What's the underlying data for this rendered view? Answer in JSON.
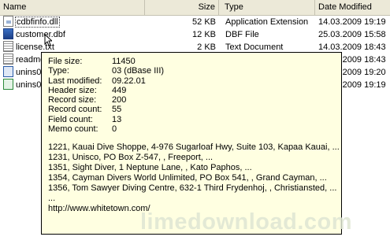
{
  "columns": {
    "name": "Name",
    "size": "Size",
    "type": "Type",
    "date": "Date Modified"
  },
  "files": [
    {
      "name": "cdbfinfo.dll",
      "size": "52 KB",
      "type": "Application Extension",
      "date": "14.03.2009 19:19",
      "icon": "dll-file-icon"
    },
    {
      "name": "customer.dbf",
      "size": "12 KB",
      "type": "DBF File",
      "date": "25.03.2009 15:58",
      "icon": "dbf-file-icon"
    },
    {
      "name": "license.txt",
      "size": "2 KB",
      "type": "Text Document",
      "date": "14.03.2009 18:43",
      "icon": "text-file-icon"
    },
    {
      "name": "readme.txt",
      "size": "",
      "type": "",
      "date": "14.03.2009 18:43",
      "icon": "text-file-icon"
    },
    {
      "name": "unins000.dat",
      "size": "",
      "type": "",
      "date": "14.03.2009 19:20",
      "icon": "dat-file-icon"
    },
    {
      "name": "unins000.exe",
      "size": "",
      "type": "",
      "date": "14.03.2009 19:19",
      "icon": "exe-file-icon"
    }
  ],
  "tooltip": {
    "fields": [
      {
        "label": "File size:",
        "value": "11450"
      },
      {
        "label": "Type:",
        "value": "03 (dBase III)"
      },
      {
        "label": "Last modified:",
        "value": "09.22.01"
      },
      {
        "label": "Header size:",
        "value": "449"
      },
      {
        "label": "Record size:",
        "value": "200"
      },
      {
        "label": "Record count:",
        "value": "55"
      },
      {
        "label": "Field count:",
        "value": "13"
      },
      {
        "label": "Memo count:",
        "value": "0"
      }
    ],
    "records": [
      "1221, Kauai Dive Shoppe, 4-976 Sugarloaf Hwy, Suite 103, Kapaa Kauai, ...",
      "1231, Unisco, PO Box Z-547, , Freeport, ...",
      "1351, Sight Diver, 1 Neptune Lane, , Kato Paphos, ...",
      "1354, Cayman Divers World Unlimited, PO Box 541, , Grand Cayman, ...",
      "1356, Tom Sawyer Diving Centre, 632-1 Third Frydenhoj, , Christiansted, ...",
      "..."
    ],
    "url": "http://www.whitetown.com/"
  },
  "watermark": "limedownload.com"
}
